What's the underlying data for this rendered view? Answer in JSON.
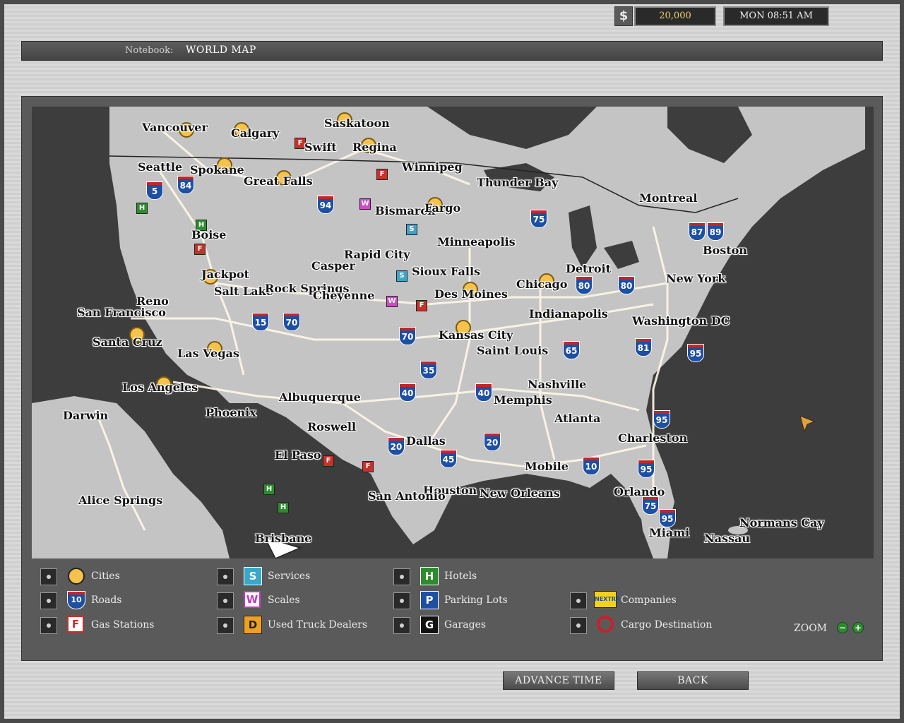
{
  "status": {
    "money": "20,000",
    "money_symbol": "$",
    "time": "MON 08:51 AM"
  },
  "notebook": {
    "label": "Notebook:",
    "value": "WORLD MAP"
  },
  "cities": [
    "Vancouver",
    "Calgary",
    "Saskatoon",
    "Swift",
    "Regina",
    "Seattle",
    "Spokane",
    "Great Falls",
    "Winnipeg",
    "Thunder Bay",
    "Montreal",
    "Bismarck",
    "Fargo",
    "Boise",
    "Minneapolis",
    "Boston",
    "Rapid City",
    "Casper",
    "Sioux Falls",
    "Detroit",
    "Jackpot",
    "New York",
    "Reno",
    "Salt Lake",
    "Rock Springs",
    "Cheyenne",
    "Chicago",
    "Des Moines",
    "San Francisco",
    "Indianapolis",
    "Washington DC",
    "Santa Cruz",
    "Kansas City",
    "Las Vegas",
    "Saint Louis",
    "Los Angeles",
    "Nashville",
    "Albuquerque",
    "Memphis",
    "Phoenix",
    "Atlanta",
    "Darwin",
    "Roswell",
    "Charleston",
    "Dallas",
    "El Paso",
    "Mobile",
    "Alice Springs",
    "Houston",
    "San Antonio",
    "New Orleans",
    "Orlando",
    "Normans Cay",
    "Miami",
    "Nassau",
    "Brisbane"
  ],
  "legend": [
    {
      "label": "Cities",
      "icon": "city-icon",
      "glyph": ""
    },
    {
      "label": "Services",
      "icon": "services-icon",
      "glyph": "S"
    },
    {
      "label": "Hotels",
      "icon": "hotel-icon",
      "glyph": "H"
    },
    {
      "label": "Roads",
      "icon": "road-icon",
      "glyph": "10"
    },
    {
      "label": "Scales",
      "icon": "scale-icon",
      "glyph": "W"
    },
    {
      "label": "Parking Lots",
      "icon": "parking-icon",
      "glyph": "P"
    },
    {
      "label": "Companies",
      "icon": "company-icon",
      "glyph": "NEXTRA"
    },
    {
      "label": "Gas Stations",
      "icon": "gas-icon",
      "glyph": "F"
    },
    {
      "label": "Used Truck Dealers",
      "icon": "dealer-icon",
      "glyph": "D"
    },
    {
      "label": "Garages",
      "icon": "garage-icon",
      "glyph": "G"
    },
    {
      "label": "Cargo Destination",
      "icon": "cargo-icon",
      "glyph": ""
    }
  ],
  "zoom": {
    "label": "ZOOM",
    "minus": "−",
    "plus": "+"
  },
  "buttons": {
    "advance": "ADVANCE TIME",
    "back": "BACK"
  }
}
